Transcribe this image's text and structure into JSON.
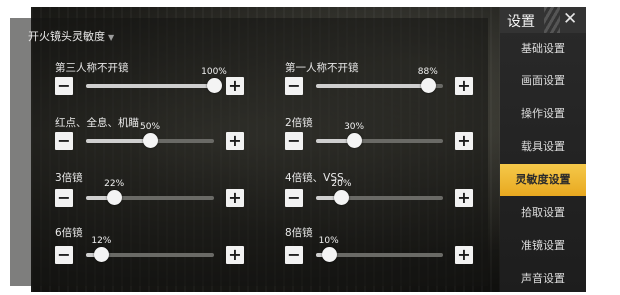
{
  "panel": {
    "title": "开火镜头灵敏度",
    "left_column": [
      {
        "label": "第三人称不开镜",
        "value": 100
      },
      {
        "label": "红点、全息、机瞄",
        "value": 50
      },
      {
        "label": "3倍镜",
        "value": 22
      },
      {
        "label": "6倍镜",
        "value": 12
      }
    ],
    "right_column": [
      {
        "label": "第一人称不开镜",
        "value": 88
      },
      {
        "label": "2倍镜",
        "value": 30
      },
      {
        "label": "4倍镜、VSS",
        "value": 20
      },
      {
        "label": "8倍镜",
        "value": 10
      }
    ],
    "minus_symbol": "−",
    "plus_symbol": "+",
    "value_suffix": "%"
  },
  "sidebar": {
    "title": "设置",
    "close_symbol": "✕",
    "items": [
      {
        "label": "基础设置",
        "active": false
      },
      {
        "label": "画面设置",
        "active": false
      },
      {
        "label": "操作设置",
        "active": false
      },
      {
        "label": "载具设置",
        "active": false
      },
      {
        "label": "灵敏度设置",
        "active": true
      },
      {
        "label": "拾取设置",
        "active": false
      },
      {
        "label": "准镜设置",
        "active": false
      },
      {
        "label": "声音设置",
        "active": false
      }
    ]
  },
  "colors": {
    "active_accent": "#f0b930",
    "track": "#6a6a66",
    "fill": "#cfcfcf"
  }
}
